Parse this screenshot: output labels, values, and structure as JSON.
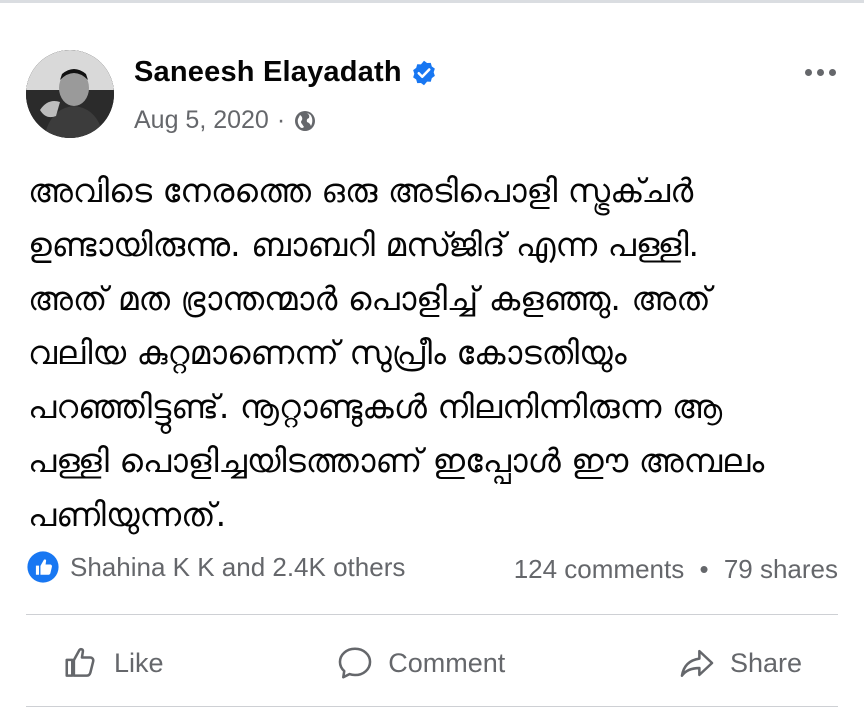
{
  "post": {
    "author": "Saneesh Elayadath",
    "date": "Aug 5, 2020",
    "audience_icon": "globe-icon",
    "text_lines": [
      "അവിടെ നേരത്തെ ഒരു അടിപൊളി സ്ട്രക്ചർ",
      "ഉണ്ടായിരുന്നു. ബാബറി മസ്ജിദ് എന്ന പള്ളി.",
      "അത് മത ഭ്രാന്തന്മാർ പൊളിച്ച് കളഞ്ഞു. അത്",
      "വലിയ കുറ്റമാണെന്ന് സുപ്രീം കോടതിയും",
      "പറഞ്ഞിട്ടുണ്ട്. നൂറ്റാണ്ടുകൾ നിലനിന്നിരുന്ന ആ",
      "പള്ളി പൊളിച്ചയിടത്താണ് ഇപ്പോൾ ഈ അമ്പലം",
      "പണിയുന്നത്."
    ]
  },
  "stats": {
    "reactions": "Shahina K K and 2.4K others",
    "comments": "124 comments",
    "separator": "•",
    "shares": "79 shares"
  },
  "actions": {
    "like": "Like",
    "comment": "Comment",
    "share": "Share"
  },
  "colors": {
    "accent": "#1877f2",
    "secondary_text": "#65676b"
  }
}
